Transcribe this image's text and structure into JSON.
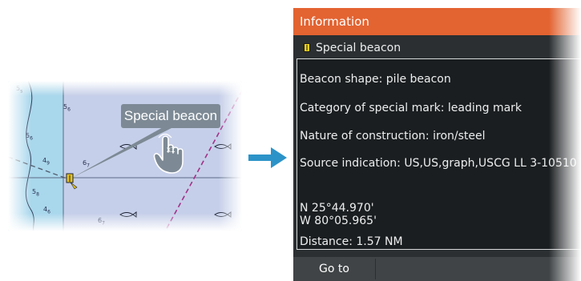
{
  "chart": {
    "callout_label": "Special beacon",
    "tap_count": "x1",
    "depth_labels": [
      "5",
      "5",
      "5",
      "4",
      "6",
      "5",
      "4",
      "6"
    ],
    "depth_subs": [
      "s",
      "6",
      "6",
      "9",
      "7",
      "8",
      "6",
      "7"
    ]
  },
  "panel": {
    "title": "Information",
    "object_name": "Special beacon",
    "details": {
      "shape": "Beacon shape: pile beacon",
      "category": "Category of special mark: leading mark",
      "construction": "Nature of construction: iron/steel",
      "source": "Source indication: US,US,graph,USCG LL 3-10510",
      "lat": "N  25°44.970'",
      "lon": "W  80°05.965'",
      "distance": "Distance: 1.57 NM"
    },
    "goto_label": "Go to"
  },
  "colors": {
    "title_bar": "#e36331",
    "panel_bg": "#2b2f31",
    "details_bg": "#1b1e20",
    "sea_deep": "#c6cfe9",
    "sea_shallow": "#a9d7ec",
    "track_purple": "#a0338a",
    "arrow": "#2c93c8"
  },
  "icons": [
    "beacon-icon",
    "hand-tap-icon",
    "right-arrow-icon",
    "fish-symbol-icon"
  ]
}
